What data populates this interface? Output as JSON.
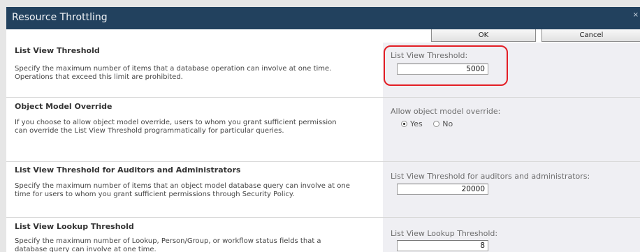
{
  "dialog": {
    "title": "Resource Throttling",
    "close_glyph": "×"
  },
  "buttons": {
    "ok_label": "OK",
    "cancel_label": "Cancel"
  },
  "sections": [
    {
      "title": "List View Threshold",
      "description": "Specify the maximum number of items that a database operation can involve at one time. Operations that exceed this limit are prohibited.",
      "field_label": "List View Threshold:",
      "value": "5000"
    },
    {
      "title": "Object Model Override",
      "description": "If you choose to allow object model override, users to whom you grant sufficient permission can override the List View Threshold programmatically for particular queries.",
      "field_label": "Allow object model override:",
      "options": [
        {
          "label": "Yes",
          "checked": true
        },
        {
          "label": "No",
          "checked": false
        }
      ]
    },
    {
      "title": "List View Threshold for Auditors and Administrators",
      "description": "Specify the maximum number of items that an object model database query can involve at one time for users to whom you grant sufficient permissions through Security Policy.",
      "field_label": "List View Threshold for auditors and administrators:",
      "value": "20000"
    },
    {
      "title": "List View Lookup Threshold",
      "description": "Specify the maximum number of Lookup, Person/Group, or workflow status fields that a database query can involve at one time.",
      "field_label": "List View Lookup Threshold:",
      "value": "8"
    }
  ],
  "colors": {
    "titlebar": "#22415e",
    "highlight": "#e31e25",
    "right_panel": "#efeff3"
  }
}
